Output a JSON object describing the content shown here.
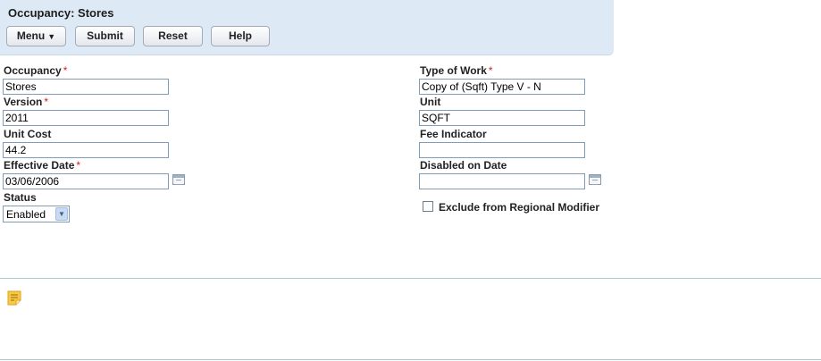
{
  "header": {
    "title": "Occupancy: Stores",
    "menu_label": "Menu",
    "menu_arrow_icon": "chevron-down-icon",
    "submit_label": "Submit",
    "reset_label": "Reset",
    "help_label": "Help"
  },
  "form": {
    "required_mark": "*",
    "occupancy": {
      "label": "Occupancy",
      "value": "Stores"
    },
    "version": {
      "label": "Version",
      "value": "2011"
    },
    "unit_cost": {
      "label": "Unit Cost",
      "value": "44.2"
    },
    "effective_date": {
      "label": "Effective Date",
      "value": "03/06/2006"
    },
    "status": {
      "label": "Status",
      "value": "Enabled"
    },
    "type_of_work": {
      "label": "Type of Work",
      "value": "Copy of (Sqft) Type V - N"
    },
    "unit": {
      "label": "Unit",
      "value": "SQFT"
    },
    "fee_indicator": {
      "label": "Fee Indicator",
      "value": ""
    },
    "disabled_on_date": {
      "label": "Disabled on Date",
      "value": ""
    },
    "exclude_regional": {
      "label": "Exclude from Regional Modifier",
      "checked": false
    }
  },
  "notes": {
    "icon": "note-icon"
  },
  "colors": {
    "header_bg": "#dde9f5",
    "required": "#d02020",
    "divider": "#a9cccc",
    "note_icon": "#f0b429"
  }
}
